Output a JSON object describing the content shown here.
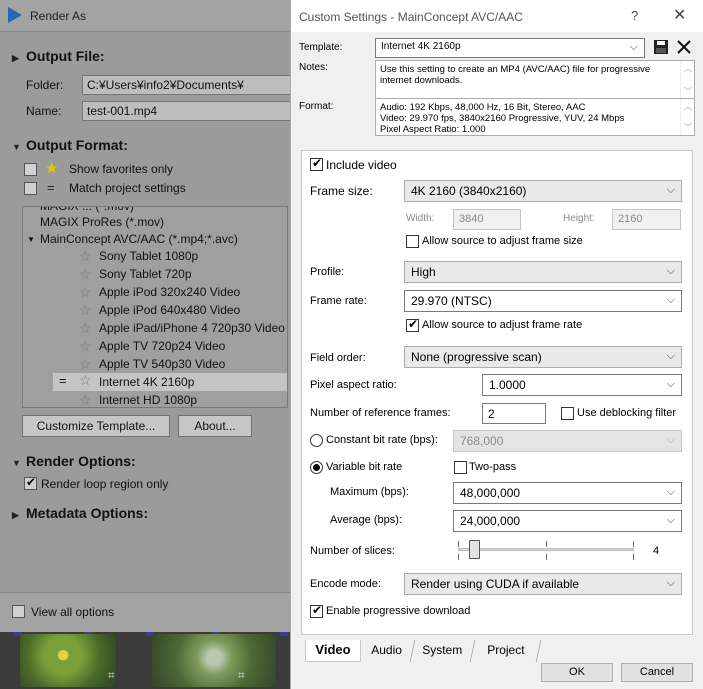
{
  "render_as": {
    "title": "Render As",
    "output_file": {
      "heading": "Output File:",
      "folder_label": "Folder:",
      "folder_value": "C:¥Users¥info2¥Documents¥",
      "name_label": "Name:",
      "name_value": "test-001.mp4"
    },
    "output_format": {
      "heading": "Output Format:",
      "show_favorites_label": "Show favorites only",
      "match_project_label": "Match project settings",
      "tree": [
        {
          "text": "MAGIX ProRes (*.mov)",
          "level": 0
        },
        {
          "text": "MainConcept AVC/AAC (*.mp4;*.avc)",
          "level": 0,
          "expanded": true
        },
        {
          "text": "Sony Tablet 1080p",
          "level": 1
        },
        {
          "text": "Sony Tablet 720p",
          "level": 1
        },
        {
          "text": "Apple iPod 320x240 Video",
          "level": 1
        },
        {
          "text": "Apple iPod 640x480 Video",
          "level": 1
        },
        {
          "text": "Apple iPad/iPhone 4 720p30 Video",
          "level": 1
        },
        {
          "text": "Apple TV 720p24 Video",
          "level": 1
        },
        {
          "text": "Apple TV 540p30 Video",
          "level": 1
        },
        {
          "text": "Internet 4K 2160p",
          "level": 1,
          "selected": true
        },
        {
          "text": "Internet HD 1080p",
          "level": 1
        }
      ],
      "customize_button": "Customize Template...",
      "about_button": "About..."
    },
    "render_options": {
      "heading": "Render Options:",
      "render_loop_label": "Render loop region only"
    },
    "metadata_options": {
      "heading": "Metadata Options:"
    },
    "view_all_label": "View all options"
  },
  "custom_settings": {
    "title": "Custom Settings - MainConcept AVC/AAC",
    "help_glyph": "?",
    "close_glyph": "✕",
    "template_label": "Template:",
    "template_value": "Internet 4K 2160p",
    "notes_label": "Notes:",
    "notes_text": "Use this setting to create an MP4 (AVC/AAC) file for progressive internet downloads.",
    "format_label": "Format:",
    "format_lines": [
      "Audio: 192 Kbps, 48,000 Hz, 16 Bit, Stereo, AAC",
      "Video: 29.970 fps, 3840x2160 Progressive, YUV, 24 Mbps",
      "Pixel Aspect Ratio: 1.000"
    ],
    "video": {
      "include_video_label": "Include video",
      "frame_size_label": "Frame size:",
      "frame_size_value": "4K 2160 (3840x2160)",
      "width_label": "Width:",
      "width_value": "3840",
      "height_label": "Height:",
      "height_value": "2160",
      "allow_frame_size_label": "Allow source to adjust frame size",
      "profile_label": "Profile:",
      "profile_value": "High",
      "frame_rate_label": "Frame rate:",
      "frame_rate_value": "29.970 (NTSC)",
      "allow_frame_rate_label": "Allow source to adjust frame rate",
      "field_order_label": "Field order:",
      "field_order_value": "None (progressive scan)",
      "pixel_aspect_label": "Pixel aspect ratio:",
      "pixel_aspect_value": "1.0000",
      "ref_frames_label": "Number of reference frames:",
      "ref_frames_value": "2",
      "deblocking_label": "Use deblocking filter",
      "cbr_label": "Constant bit rate (bps):",
      "cbr_value": "768,000",
      "vbr_label": "Variable bit rate",
      "two_pass_label": "Two-pass",
      "maximum_label": "Maximum (bps):",
      "maximum_value": "48,000,000",
      "average_label": "Average (bps):",
      "average_value": "24,000,000",
      "slices_label": "Number of slices:",
      "slices_value": "4",
      "encode_mode_label": "Encode mode:",
      "encode_mode_value": "Render using CUDA if available",
      "progressive_download_label": "Enable progressive download"
    },
    "tabs": [
      "Video",
      "Audio",
      "System",
      "Project"
    ],
    "active_tab": "Video",
    "ok_button": "OK",
    "cancel_button": "Cancel"
  }
}
